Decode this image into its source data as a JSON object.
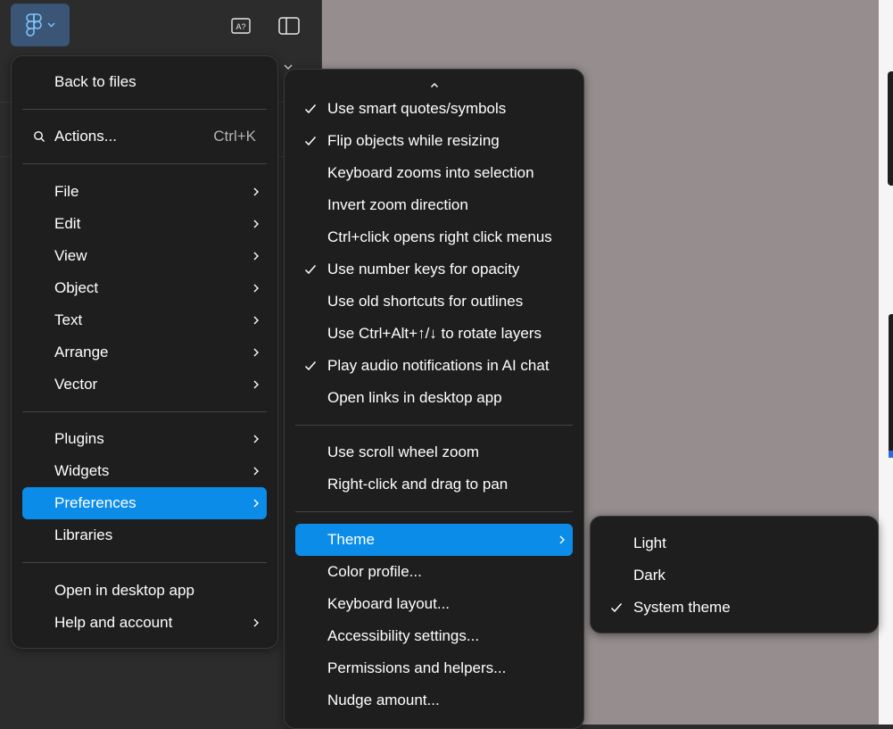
{
  "colors": {
    "accent": "#0c8ce9",
    "menu_bg": "#1e1e1e",
    "canvas": "#968e8e",
    "panel": "#2c2c2c"
  },
  "toolbar": {
    "logo_icon": "figma-logo-icon",
    "logo_chevron": "chevron-down-icon",
    "text_icon_label": "A?",
    "panel_icon": "sidebar-panel-icon"
  },
  "main_menu": {
    "back": "Back to files",
    "actions": {
      "label": "Actions...",
      "shortcut": "Ctrl+K",
      "icon": "search-icon"
    },
    "group1": [
      "File",
      "Edit",
      "View",
      "Object",
      "Text",
      "Arrange",
      "Vector"
    ],
    "group2": [
      "Plugins",
      "Widgets",
      "Preferences",
      "Libraries"
    ],
    "group3": [
      "Open in desktop app",
      "Help and account"
    ]
  },
  "prefs_menu": {
    "group1": [
      {
        "label": "Use smart quotes/symbols",
        "checked": true
      },
      {
        "label": "Flip objects while resizing",
        "checked": true
      },
      {
        "label": "Keyboard zooms into selection",
        "checked": false
      },
      {
        "label": "Invert zoom direction",
        "checked": false
      },
      {
        "label": "Ctrl+click opens right click menus",
        "checked": false
      },
      {
        "label": "Use number keys for opacity",
        "checked": true
      },
      {
        "label": "Use old shortcuts for outlines",
        "checked": false
      },
      {
        "label": "Use Ctrl+Alt+↑/↓ to rotate layers",
        "checked": false
      },
      {
        "label": "Play audio notifications in AI chat",
        "checked": true
      },
      {
        "label": "Open links in desktop app",
        "checked": false
      }
    ],
    "group2": [
      "Use scroll wheel zoom",
      "Right-click and drag to pan"
    ],
    "group3": [
      "Theme",
      "Color profile...",
      "Keyboard layout...",
      "Accessibility settings...",
      "Permissions and helpers...",
      "Nudge amount..."
    ]
  },
  "theme_menu": [
    {
      "label": "Light",
      "checked": false
    },
    {
      "label": "Dark",
      "checked": false
    },
    {
      "label": "System theme",
      "checked": true
    }
  ]
}
